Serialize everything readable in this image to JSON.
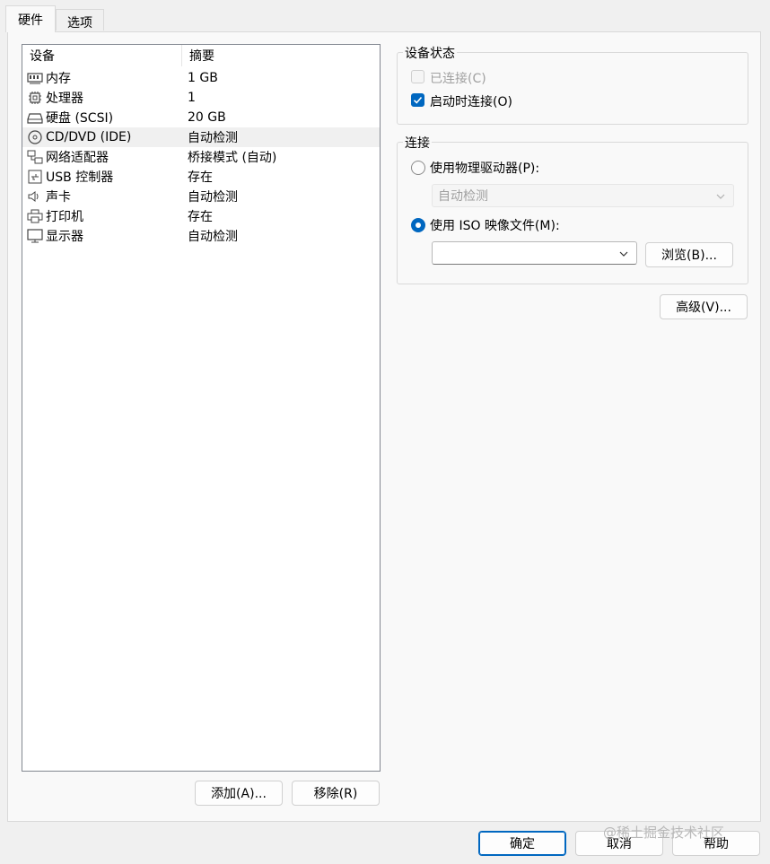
{
  "tabs": [
    {
      "label": "硬件",
      "active": true
    },
    {
      "label": "选项",
      "active": false
    }
  ],
  "device_table": {
    "columns": [
      "设备",
      "摘要"
    ],
    "rows": [
      {
        "icon": "memory-icon",
        "name": "内存",
        "summary": "1 GB"
      },
      {
        "icon": "processor-icon",
        "name": "处理器",
        "summary": "1"
      },
      {
        "icon": "hard-disk-icon",
        "name": "硬盘 (SCSI)",
        "summary": "20 GB"
      },
      {
        "icon": "cd-dvd-icon",
        "name": "CD/DVD (IDE)",
        "summary": "自动检测",
        "selected": true
      },
      {
        "icon": "network-adapter-icon",
        "name": "网络适配器",
        "summary": "桥接模式 (自动)"
      },
      {
        "icon": "usb-icon",
        "name": "USB 控制器",
        "summary": "存在"
      },
      {
        "icon": "sound-card-icon",
        "name": "声卡",
        "summary": "自动检测"
      },
      {
        "icon": "printer-icon",
        "name": "打印机",
        "summary": "存在"
      },
      {
        "icon": "display-icon",
        "name": "显示器",
        "summary": "自动检测"
      }
    ]
  },
  "list_buttons": {
    "add": "添加(A)...",
    "remove": "移除(R)"
  },
  "device_status": {
    "title": "设备状态",
    "connected": {
      "label": "已连接(C)",
      "checked": false,
      "enabled": false
    },
    "connect_at_power_on": {
      "label": "启动时连接(O)",
      "checked": true
    }
  },
  "connection": {
    "title": "连接",
    "physical_drive": {
      "label": "使用物理驱动器(P):",
      "selected": false,
      "value": "自动检测"
    },
    "iso_image": {
      "label": "使用 ISO 映像文件(M):",
      "selected": true,
      "value": ""
    },
    "browse": "浏览(B)..."
  },
  "advanced_button": "高级(V)...",
  "footer": {
    "ok": "确定",
    "cancel": "取消",
    "help": "帮助"
  },
  "watermark": "@稀土掘金技术社区",
  "colors": {
    "accent": "#0067c0",
    "panel": "#f9f9f9",
    "window": "#f0f0f0"
  }
}
